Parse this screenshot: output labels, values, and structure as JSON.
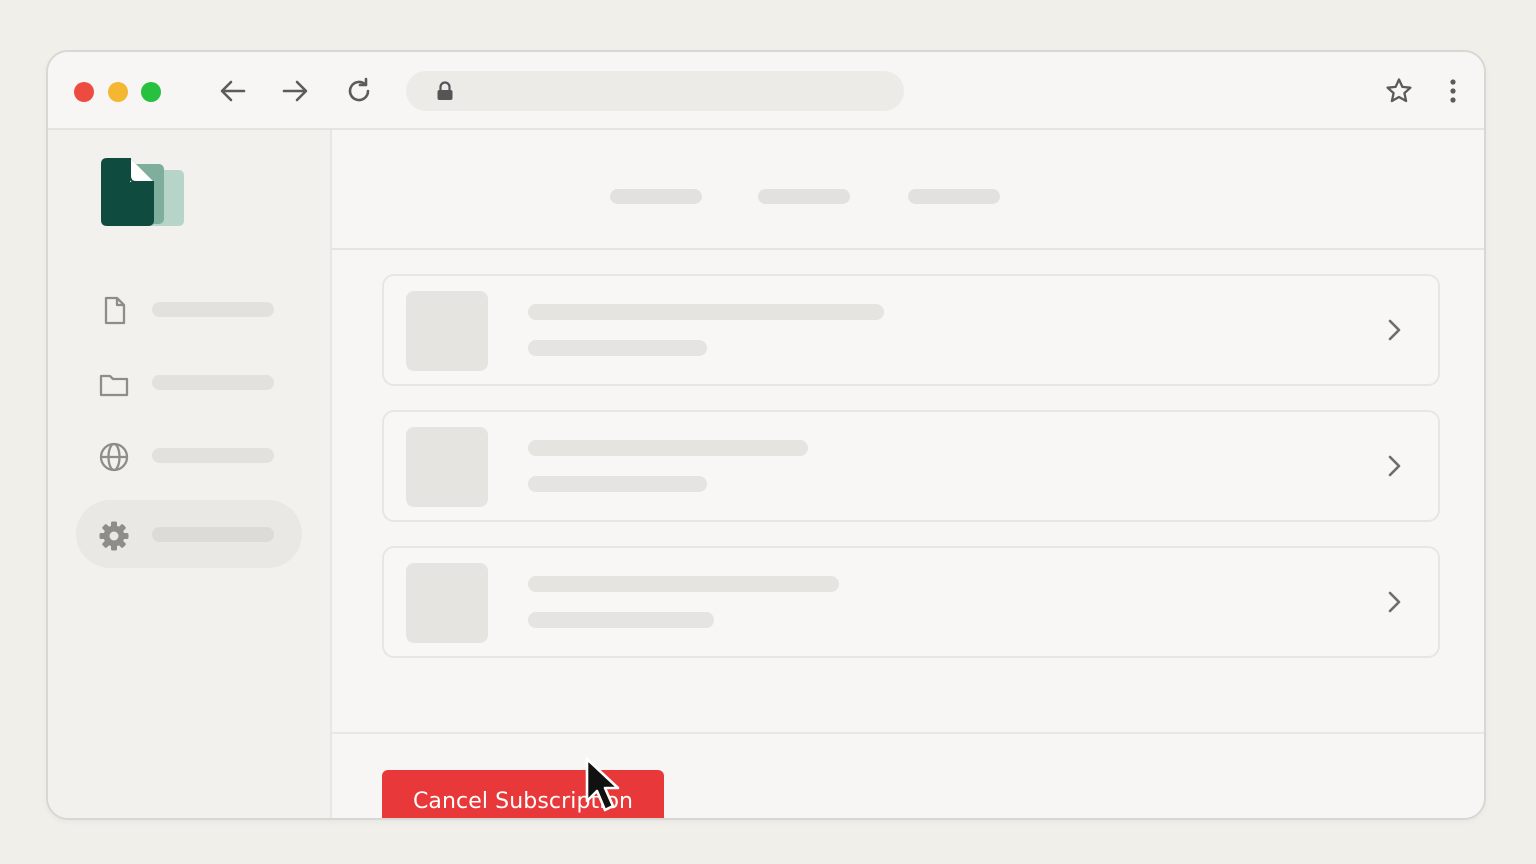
{
  "main": {
    "cancel_button_label": "Cancel Subscription"
  },
  "colors": {
    "accent_red": "#e93839",
    "logo_dark": "#0f4b3e",
    "logo_light": "#b6d4c7"
  },
  "icons": {
    "sidebar": [
      "document-icon",
      "folder-icon",
      "globe-icon",
      "gear-icon"
    ],
    "toolbar": [
      "back-arrow-icon",
      "forward-arrow-icon",
      "reload-icon",
      "lock-icon",
      "star-icon",
      "more-vertical-icon"
    ]
  },
  "sidebar": {
    "active_item": "settings"
  }
}
